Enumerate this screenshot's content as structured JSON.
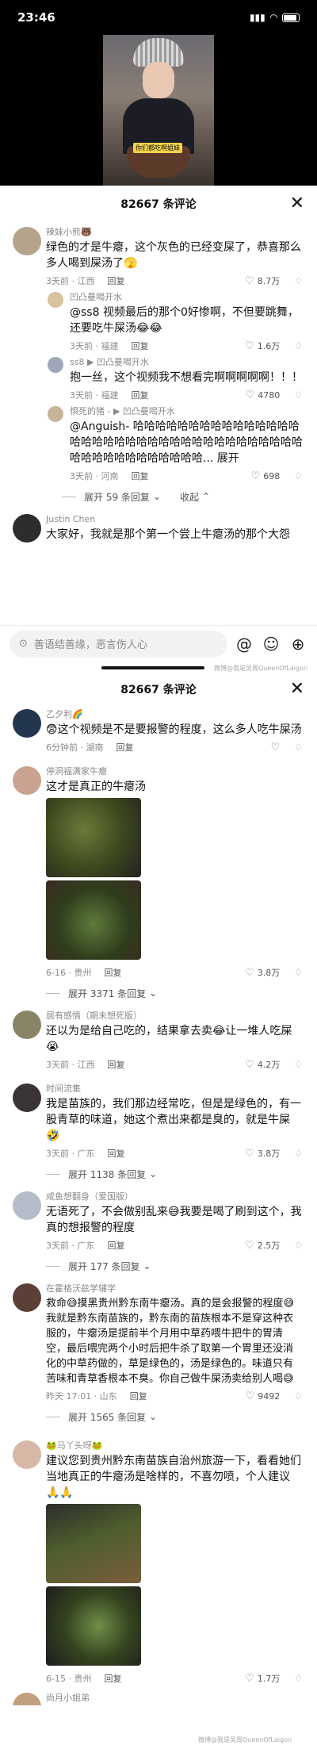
{
  "status": {
    "time": "23:46",
    "signal": "📶",
    "wifi": "◠"
  },
  "video": {
    "caption": "你们都吃啊姐妹"
  },
  "sheet1": {
    "title": "82667 条评论",
    "comments": [
      {
        "user": "辣妹小熊🐻",
        "text": "绿色的才是牛瘪，这个灰色的已经变屎了，恭喜那么多人喝到屎汤了🫣",
        "time": "3天前 · 江西",
        "reply": "回复",
        "likes": "8.7万"
      },
      {
        "user": "凹凸曼喝开水",
        "text": "@ss8 视频最后的那个0好惨啊，不但要跳舞，还要吃牛屎汤😂😂",
        "time": "3天前 · 福建",
        "reply": "回复",
        "likes": "1.6万"
      },
      {
        "user": "ss8 ▶ 凹凸曼喝开水",
        "text": "抱一丝，这个视频我不想看完啊啊啊啊啊！！！",
        "time": "3天前 · 福建",
        "reply": "回复",
        "likes": "4780"
      },
      {
        "user": "惧死的猪 - ▶ 凹凸曼喝开水",
        "text": "@Anguish- 哈哈哈哈哈哈哈哈哈哈哈哈哈哈哈哈哈哈哈哈哈哈哈哈哈哈哈哈哈哈哈哈哈哈哈哈哈哈哈哈哈哈哈哈哈哈哈哈... 展开",
        "time": "3天前 · 河南",
        "reply": "回复",
        "likes": "698"
      }
    ],
    "expand_replies": "展开 59 条回复",
    "collapse": "收起",
    "last_user": "Justin Chen",
    "last_text": "大家好，我就是那个第一个尝上牛瘪汤的那个大怨",
    "input_placeholder": "善语结善缘，恶言伤人心"
  },
  "watermarks": [
    "微博@我是吴周QueenOfLaigon",
    "微博@我是吴周QueenOfLaigon"
  ],
  "sheet2": {
    "title": "82667 条评论",
    "comments": [
      {
        "user": "乙夕利🌈",
        "text": "😨这个视频是不是要报警的程度，这么多人吃牛屎汤",
        "time": "6分钟前 · 湖南",
        "reply": "回复",
        "likes": ""
      },
      {
        "user": "停洞福满家牛瘪",
        "text": "这才是真正的牛瘪汤",
        "time": "6-16 · 贵州",
        "reply": "回复",
        "likes": "3.8万",
        "has_images": true
      },
      {
        "user": "居有感情（期末想死版）",
        "text": "还以为是给自己吃的，结果拿去卖😂让一堆人吃屎😭",
        "time": "3天前 · 江西",
        "reply": "回复",
        "likes": "4.2万"
      },
      {
        "user": "时间流集",
        "text": "我是苗族的，我们那边经常吃，但是是绿色的，有一股青草的味道，她这个煮出来都是臭的，就是牛屎🤣",
        "time": "3天前 · 广东",
        "reply": "回复",
        "likes": "3.8万"
      },
      {
        "user": "咸鱼想翻身（爱国版）",
        "text": "无语死了，不会做别乱来😅我要是喝了刷到这个，我真的想报警的程度",
        "time": "3天前 · 广东",
        "reply": "回复",
        "likes": "2.5万"
      },
      {
        "user": "在霍格沃兹学辅学",
        "text": "救命😅摸黑贵州黔东南牛瘪汤。真的是会报警的程度😅我就是黔东南苗族的，黔东南的苗族根本不是穿这种衣服的，牛瘪汤是提前半个月用中草药喂牛把牛的胃清空，最后喂完两个小时后把牛杀了取第一个胃里还没消化的中草药做的，草是绿色的，汤是绿色的。味道只有苦味和青草香根本不臭。你自己做牛屎汤卖给别人喝😅",
        "time": "昨天 17:01 · 山东",
        "reply": "回复",
        "likes": "9492"
      },
      {
        "user": "🐸马丫头呀🐸",
        "text": "建议您到贵州黔东南苗族自治州旅游一下，看看她们当地真正的牛瘪汤是啥样的，不喜勿喷，个人建议🙏🙏",
        "time": "6-15 · 贵州",
        "reply": "回复",
        "likes": "1.7万",
        "has_images": true
      }
    ],
    "expands": [
      "展开 3371 条回复",
      "展开 1138 条回复",
      "展开 177 条回复",
      "展开 1565 条回复"
    ],
    "partial_user": "尚月小姐弟"
  }
}
